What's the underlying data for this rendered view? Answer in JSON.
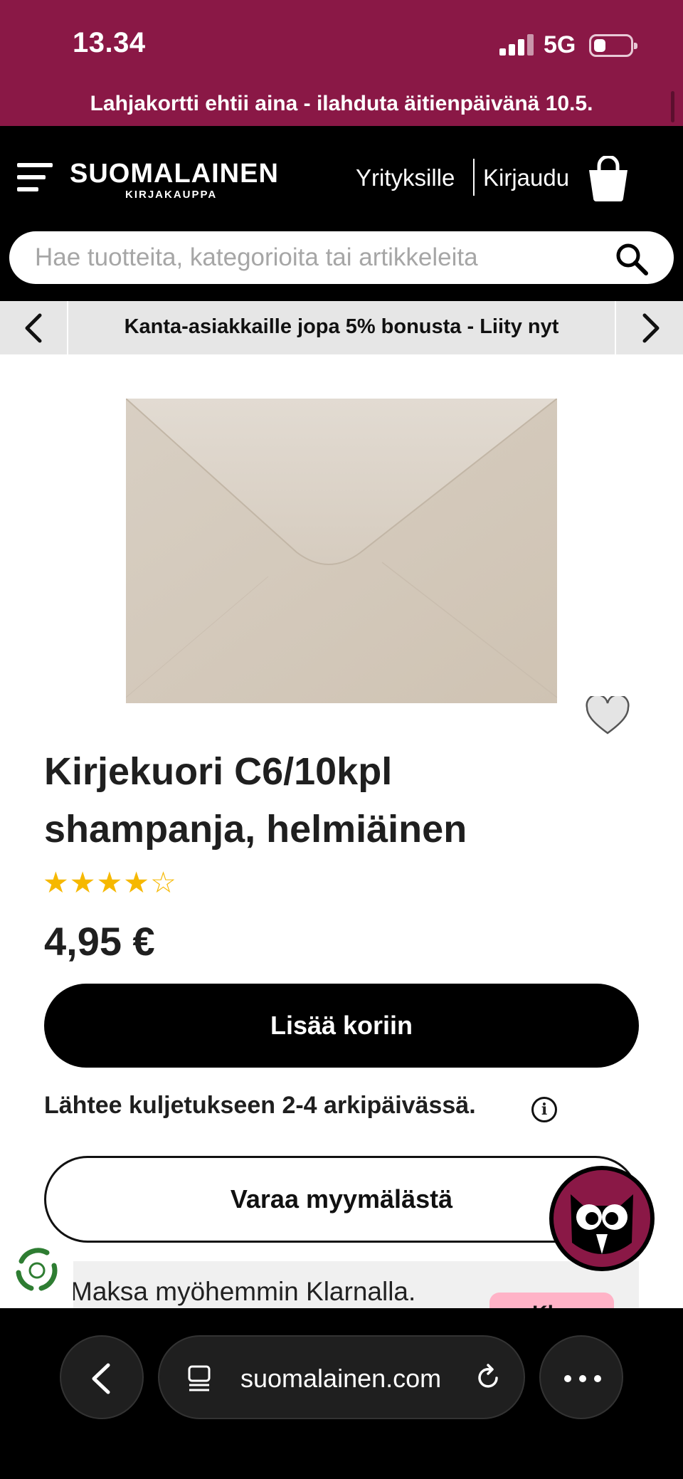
{
  "status_bar": {
    "time": "13.34",
    "network": "5G",
    "battery_icon": "battery-icon",
    "signal_icon": "signal-icon"
  },
  "promo_banner": {
    "text": "Lahjakortti ehtii aina - ilahduta äitienpäivänä 10.5."
  },
  "header": {
    "logo": {
      "main": "SUOMALAINEN",
      "sub": "KIRJAKAUPPA"
    },
    "links": {
      "business": "Yrityksille",
      "login": "Kirjaudu"
    },
    "icons": {
      "menu": "hamburger-menu-icon",
      "cart": "shopping-bag-icon",
      "search": "search-icon"
    },
    "search": {
      "placeholder": "Hae tuotteita, kategorioita tai artikkeleita",
      "value": ""
    }
  },
  "bonus_banner": {
    "text": "Kanta-asiakkaille jopa 5% bonusta - Liity nyt"
  },
  "product": {
    "title_line1": "Kirjekuori C6/10kpl",
    "title_line2": "shampanja, helmiäinen",
    "rating": 4,
    "rating_max": 5,
    "price": "4,95 €",
    "add_to_cart": "Lisää koriin",
    "delivery": "Lähtee kuljetukseen 2-4 arkipäivässä.",
    "reserve": "Varaa myymälästä",
    "colors": {
      "envelope": "#d3c8ba",
      "star": "#f6b800"
    }
  },
  "klarna": {
    "text": "Maksa myöhemmin Klarnalla.",
    "badge": "Kl..."
  },
  "browser_bar": {
    "url": "suomalainen.com"
  },
  "colors": {
    "brand": "#8a1846",
    "header_bg": "#000000",
    "banner_bg": "#e6e6e6"
  }
}
